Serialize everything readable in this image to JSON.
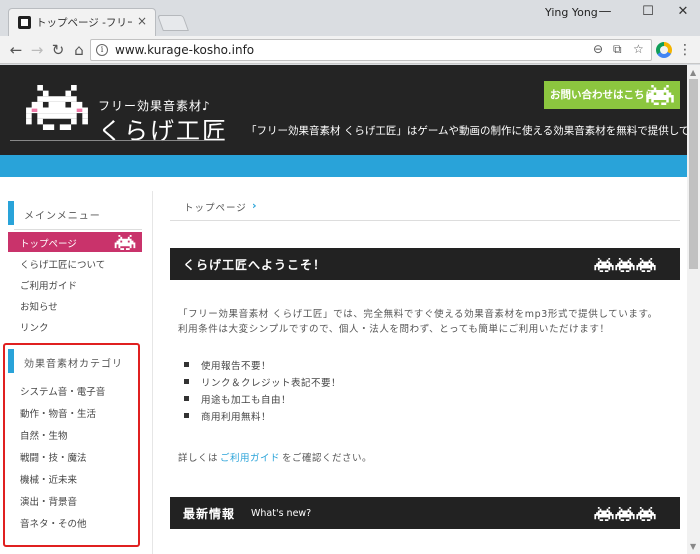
{
  "browser": {
    "tab_title": "トップページ -フリー効果",
    "tab_close": "×",
    "user_name": "Ying Yong",
    "window_controls": {
      "minimize": "—",
      "maximize": "☐",
      "close": "✕"
    },
    "nav": {
      "back": "←",
      "forward": "→",
      "reload": "↻",
      "home": "⌂"
    },
    "url": "www.kurage-kosho.info",
    "info_glyph": "i",
    "omnibox_icons": {
      "zoom": "⊖",
      "translate": "⧉",
      "bookmark": "☆"
    },
    "menu_glyph": "⋮",
    "scroll_up": "▲",
    "scroll_down": "▼"
  },
  "header": {
    "site_subtitle": "フリー効果音素材♪",
    "site_title": "くらげ工匠",
    "contact_label": "お問い合わせはこちら",
    "tagline": "「フリー効果音素材 くらげ工匠」はゲームや動画の制作に使える効果音素材を無料で提供しています"
  },
  "sidebar": {
    "main_menu_heading": "メインメニュー",
    "main_menu": [
      {
        "label": "トップページ",
        "active": true
      },
      {
        "label": "くらげ工匠について"
      },
      {
        "label": "ご利用ガイド"
      },
      {
        "label": "お知らせ"
      },
      {
        "label": "リンク"
      }
    ],
    "category_heading": "効果音素材カテゴリ",
    "categories": [
      {
        "label": "システム音・電子音"
      },
      {
        "label": "動作・物音・生活"
      },
      {
        "label": "自然・生物"
      },
      {
        "label": "戦闘・技・魔法"
      },
      {
        "label": "機械・近未来"
      },
      {
        "label": "演出・背景音"
      },
      {
        "label": "音ネタ・その他"
      }
    ]
  },
  "main": {
    "breadcrumb": "トップページ",
    "breadcrumb_arrow": "›",
    "welcome_title": "くらげ工匠へようこそ！",
    "intro_line1": "「フリー効果音素材 くらげ工匠」では、完全無料ですぐ使える効果音素材をmp3形式で提供しています。",
    "intro_line2": "利用条件は大変シンプルですので、個人・法人を問わず、とっても簡単にご利用いただけます！",
    "bullets": [
      "使用報告不要！",
      "リンク＆クレジット表記不要！",
      "用途も加工も自由！",
      "商用利用無料！"
    ],
    "detail_prefix": "詳しくは",
    "detail_link": "ご利用ガイド",
    "detail_suffix": "をご確認ください。",
    "news_title": "最新情報",
    "news_sub": "What's new?"
  },
  "colors": {
    "header_bg": "#242424",
    "accent_blue": "#29a3d9",
    "active_pink": "#c9336b",
    "contact_green": "#8cc63f",
    "highlight_red": "#e02020"
  }
}
